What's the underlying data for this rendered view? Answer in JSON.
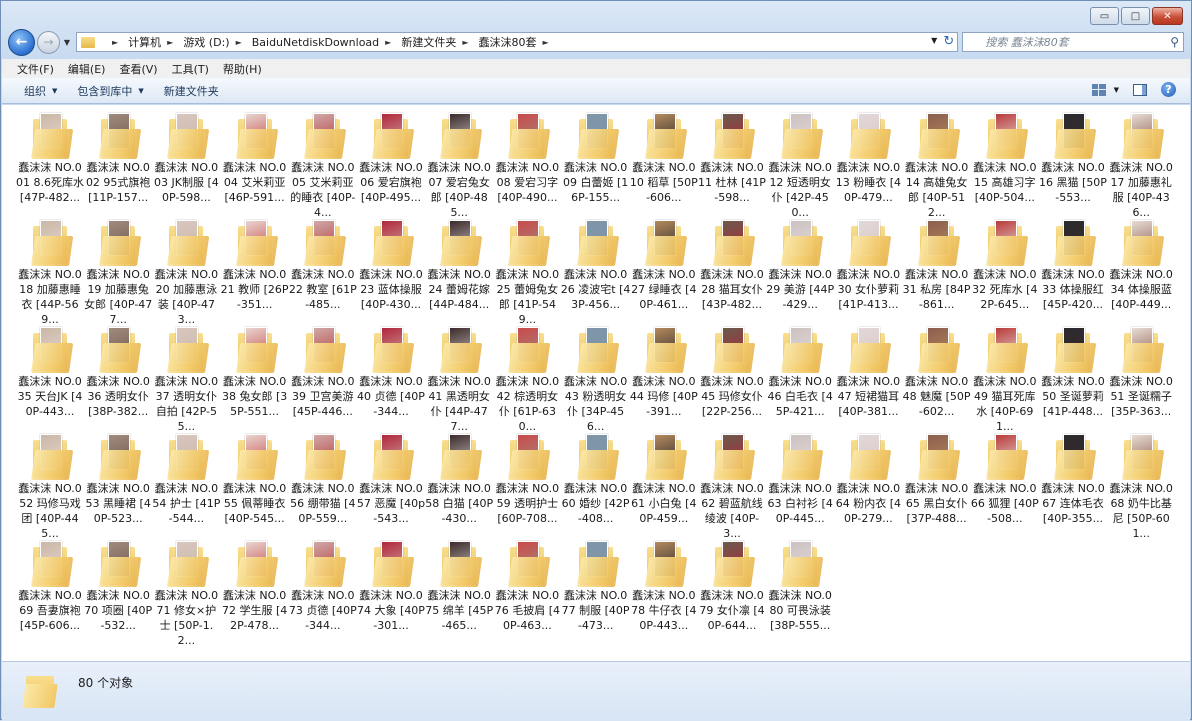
{
  "window": {
    "minimize_glyph": "▭",
    "maximize_glyph": "□",
    "close_glyph": "✕"
  },
  "address": {
    "crumbs": [
      "计算机",
      "游戏 (D:)",
      "BaiduNetdiskDownload",
      "新建文件夹",
      "蠢沫沫80套"
    ]
  },
  "search": {
    "placeholder": "搜索 蠢沫沫80套"
  },
  "menu": [
    "文件(F)",
    "编辑(E)",
    "查看(V)",
    "工具(T)",
    "帮助(H)"
  ],
  "toolbar": {
    "organize": "组织",
    "include": "包含到库中",
    "new_folder": "新建文件夹"
  },
  "status": {
    "count": "80 个对象"
  },
  "items": [
    "蠢沫沫 NO.001 8.6死库水 [47P-482...",
    "蠢沫沫 NO.002 95式旗袍 [11P-157...",
    "蠢沫沫 NO.003 JK制服 [40P-598...",
    "蠢沫沫 NO.004 艾米莉亚 [46P-591...",
    "蠢沫沫 NO.005 艾米莉亚的睡衣 [40P-4...",
    "蠢沫沫 NO.006 爱宕旗袍 [40P-495...",
    "蠢沫沫 NO.007 爱宕兔女郎 [40P-485...",
    "蠢沫沫 NO.008 爱宕习字 [40P-490...",
    "蠢沫沫 NO.009 白蕾姬 [16P-155...",
    "蠢沫沫 NO.010 稻草 [50P-606...",
    "蠢沫沫 NO.011 杜林 [41P-598...",
    "蠢沫沫 NO.012 短透明女仆 [42P-450...",
    "蠢沫沫 NO.013 粉睡衣 [40P-479...",
    "蠢沫沫 NO.014 高雄兔女郎 [40P-512...",
    "蠢沫沫 NO.015 高雄习字 [40P-504...",
    "蠢沫沫 NO.016 黑猫 [50P-553...",
    "蠢沫沫 NO.017 加藤惠礼服 [40P-436...",
    "蠢沫沫 NO.018 加藤惠睡衣 [44P-569...",
    "蠢沫沫 NO.019 加藤惠兔女郎 [40P-477...",
    "蠢沫沫 NO.020 加藤惠泳装 [40P-473...",
    "蠢沫沫 NO.021 教师 [26P-351...",
    "蠢沫沫 NO.022 教室 [61P-485...",
    "蠢沫沫 NO.023 蓝体操服 [40P-430...",
    "蠢沫沫 NO.024 蕾姆花嫁 [44P-484...",
    "蠢沫沫 NO.025 蕾姆兔女郎 [41P-549...",
    "蠢沫沫 NO.026 凌波宅t [43P-456...",
    "蠢沫沫 NO.027 绿睡衣 [40P-461...",
    "蠢沫沫 NO.028 猫耳女仆 [43P-482...",
    "蠢沫沫 NO.029 美游 [44P-429...",
    "蠢沫沫 NO.030 女仆萝莉 [41P-413...",
    "蠢沫沫 NO.031 私房 [84P-861...",
    "蠢沫沫 NO.032 死库水 [42P-645...",
    "蠢沫沫 NO.033 体操服红 [45P-420...",
    "蠢沫沫 NO.034 体操服蓝 [40P-449...",
    "蠢沫沫 NO.035 天台JK [40P-443...",
    "蠢沫沫 NO.036 透明女仆 [38P-382...",
    "蠢沫沫 NO.037 透明女仆自拍 [42P-55...",
    "蠢沫沫 NO.038 兔女郎 [35P-551...",
    "蠢沫沫 NO.039 卫宫美游 [45P-446...",
    "蠢沫沫 NO.040 贞德 [40P-344...",
    "蠢沫沫 NO.041 黑透明女仆 [44P-477...",
    "蠢沫沫 NO.042 棕透明女仆 [61P-630...",
    "蠢沫沫 NO.043 粉透明女仆 [34P-456...",
    "蠢沫沫 NO.044 玛修 [40P-391...",
    "蠢沫沫 NO.045 玛修女仆 [22P-256...",
    "蠢沫沫 NO.046 白毛衣 [45P-421...",
    "蠢沫沫 NO.047 短裙猫耳 [40P-381...",
    "蠢沫沫 NO.048 魅魔 [50P-602...",
    "蠢沫沫 NO.049 猫耳死库水 [40P-691...",
    "蠢沫沫 NO.050 圣诞萝莉 [41P-448...",
    "蠢沫沫 NO.051 圣诞糯子 [35P-363...",
    "蠢沫沫 NO.052 玛修马戏团 [40P-445...",
    "蠢沫沫 NO.053 黑睡裙 [40P-523...",
    "蠢沫沫 NO.054 护士 [41P-544...",
    "蠢沫沫 NO.055 佩蒂睡衣 [40P-545...",
    "蠢沫沫 NO.056 绷带猫 [40P-559...",
    "蠢沫沫 NO.057 恶魔 [40p-543...",
    "蠢沫沫 NO.058 白猫 [40P-430...",
    "蠢沫沫 NO.059 透明护士 [60P-708...",
    "蠢沫沫 NO.060 婚纱 [42P-408...",
    "蠢沫沫 NO.061 小白兔 [40P-459...",
    "蠢沫沫 NO.062 碧蓝航线 绫波 [40P-3...",
    "蠢沫沫 NO.063 白衬衫 [40P-445...",
    "蠢沫沫 NO.064 粉内衣 [40P-279...",
    "蠢沫沫 NO.065 黑白女仆 [37P-488...",
    "蠢沫沫 NO.066 狐狸 [40P-508...",
    "蠢沫沫 NO.067 连体毛衣 [40P-355...",
    "蠢沫沫 NO.068 奶牛比基尼 [50P-601...",
    "蠢沫沫 NO.069 吾妻旗袍 [45P-606...",
    "蠢沫沫 NO.070 项圈 [40P-532...",
    "蠢沫沫 NO.071 修女×护士 [50P-1.2...",
    "蠢沫沫 NO.072 学生服 [42P-478...",
    "蠢沫沫 NO.073 贞德 [40P-344...",
    "蠢沫沫 NO.074 大象 [40P-301...",
    "蠢沫沫 NO.075 绵羊 [45P-465...",
    "蠢沫沫 NO.076 毛披肩 [40P-463...",
    "蠢沫沫 NO.077 制服 [40P-473...",
    "蠢沫沫 NO.078 牛仔衣 [40P-443...",
    "蠢沫沫 NO.079 女仆凛 [40P-644...",
    "蠢沫沫 NO.080 可畏泳装 [38P-555..."
  ],
  "thumb_colors": [
    "#c9b8a6",
    "#a28b7e",
    "#d9c7c0",
    "#e8d5d0",
    "#cfa9a8",
    "#b0283a",
    "#3b2a2b",
    "#c94a4a",
    "#7f95a8",
    "#b58a5d",
    "#6b5a4c",
    "#ccc2c0",
    "#e2d8da",
    "#8c5e4e",
    "#b83b3b",
    "#2b2a2e",
    "#e7dcd5"
  ]
}
